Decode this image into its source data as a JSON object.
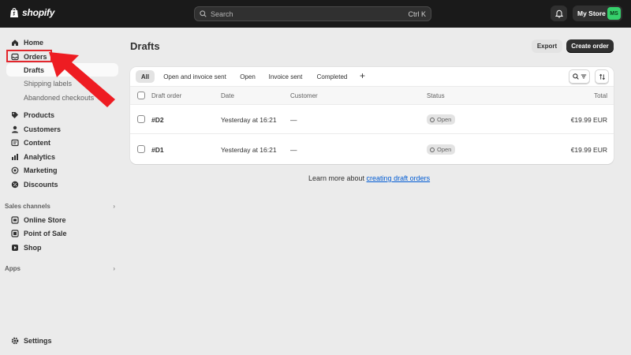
{
  "brand": {
    "name": "shopify"
  },
  "search": {
    "placeholder": "Search",
    "shortcut": "Ctrl K"
  },
  "store": {
    "name": "My Store",
    "initials": "MS"
  },
  "sidebar": {
    "items": [
      {
        "label": "Home",
        "icon": "home-icon"
      },
      {
        "label": "Orders",
        "icon": "orders-icon"
      },
      {
        "label": "Products",
        "icon": "tag-icon"
      },
      {
        "label": "Customers",
        "icon": "person-icon"
      },
      {
        "label": "Content",
        "icon": "content-icon"
      },
      {
        "label": "Analytics",
        "icon": "chart-icon"
      },
      {
        "label": "Marketing",
        "icon": "target-icon"
      },
      {
        "label": "Discounts",
        "icon": "discount-icon"
      }
    ],
    "order_subitems": [
      "Drafts",
      "Shipping labels",
      "Abandoned checkouts"
    ],
    "sales_channels_label": "Sales channels",
    "channels": [
      {
        "label": "Online Store",
        "icon": "store-icon"
      },
      {
        "label": "Point of Sale",
        "icon": "pos-icon"
      },
      {
        "label": "Shop",
        "icon": "shop-icon"
      }
    ],
    "apps_label": "Apps",
    "settings_label": "Settings"
  },
  "page": {
    "title": "Drafts",
    "export_label": "Export",
    "create_label": "Create order"
  },
  "tabs": [
    "All",
    "Open and invoice sent",
    "Open",
    "Invoice sent",
    "Completed"
  ],
  "add_tab_glyph": "+",
  "table": {
    "columns": [
      "Draft order",
      "Date",
      "Customer",
      "Status",
      "Total"
    ],
    "rows": [
      {
        "order": "#D2",
        "date": "Yesterday at 16:21",
        "customer": "—",
        "status": "Open",
        "total": "€19.99 EUR"
      },
      {
        "order": "#D1",
        "date": "Yesterday at 16:21",
        "customer": "—",
        "status": "Open",
        "total": "€19.99 EUR"
      }
    ]
  },
  "footer": {
    "text": "Learn more about ",
    "link": "creating draft orders"
  },
  "colors": {
    "topbar": "#1a1a1a",
    "accent_green": "#36d16c",
    "annotation_red": "#e3262c",
    "link_blue": "#005bd3"
  }
}
